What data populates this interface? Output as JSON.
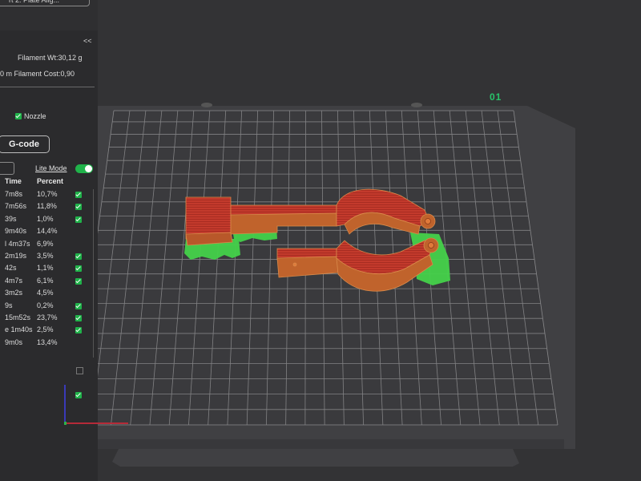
{
  "plate_button": "rt 2. Plate Alig...",
  "collapse_label": "<<",
  "filament_weight": "Filament Wt:30,12 g",
  "filament_cost": "0 m  Filament Cost:0,90",
  "nozzle_label": "Nozzle",
  "gcode_button": "G-code",
  "lite_mode_label": "Lite Mode",
  "lite_mode_on": true,
  "table": {
    "time_header": "Time",
    "percent_header": "Percent",
    "rows": [
      {
        "time": "7m8s",
        "percent": "10,7%",
        "checked": true
      },
      {
        "time": "7m56s",
        "percent": "11,8%",
        "checked": true
      },
      {
        "time": "39s",
        "percent": "1,0%",
        "checked": true
      },
      {
        "time": "9m40s",
        "percent": "14,4%",
        "checked": false
      },
      {
        "time": "l 4m37s",
        "percent": "6,9%",
        "checked": false
      },
      {
        "time": "2m19s",
        "percent": "3,5%",
        "checked": true
      },
      {
        "time": "42s",
        "percent": "1,1%",
        "checked": true
      },
      {
        "time": "4m7s",
        "percent": "6,1%",
        "checked": true
      },
      {
        "time": "3m2s",
        "percent": "4,5%",
        "checked": false
      },
      {
        "time": "9s",
        "percent": "0,2%",
        "checked": true
      },
      {
        "time": "15m52s",
        "percent": "23,7%",
        "checked": true
      },
      {
        "time": "e 1m40s",
        "percent": "2,5%",
        "checked": true
      },
      {
        "time": "9m0s",
        "percent": "13,4%",
        "checked": false
      }
    ]
  },
  "plate_number": "01",
  "colors": {
    "accent_green": "#20b34a",
    "model_red": "#c8392b",
    "model_orange": "#c86a2c",
    "support_green": "#3cc83c",
    "plate": "#3d3d40"
  }
}
